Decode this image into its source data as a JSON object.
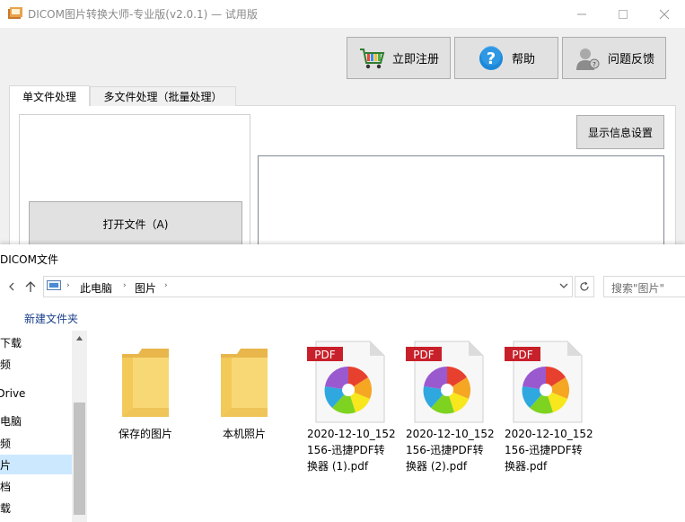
{
  "app": {
    "title": "DICOM图片转换大师-专业版(v2.0.1) — 试用版",
    "buttons": {
      "register": "立即注册",
      "help": "帮助",
      "feedback": "问题反馈"
    },
    "tabs": [
      {
        "label": "单文件处理",
        "active": true
      },
      {
        "label": "多文件处理（批量处理）",
        "active": false
      }
    ],
    "open_file": "打开文件（A)",
    "display_settings": "显示信息设置"
  },
  "dialog": {
    "title": "DICOM文件",
    "breadcrumb": [
      "此电脑",
      "图片"
    ],
    "search_placeholder": "搜索\"图片\"",
    "new_folder": "新建文件夹",
    "sidebar": [
      {
        "label": "安下载",
        "selected": false
      },
      {
        "label": "视频",
        "selected": false
      },
      {
        "label": "OneDrive",
        "selected": false
      },
      {
        "label": "此电脑",
        "selected": false
      },
      {
        "label": "视频",
        "selected": false
      },
      {
        "label": "图片",
        "selected": true
      },
      {
        "label": "文档",
        "selected": false
      },
      {
        "label": "下载",
        "selected": false
      }
    ],
    "files": [
      {
        "name_line1": "保存的图片",
        "name_line2": "",
        "name_line3": "",
        "type": "folder"
      },
      {
        "name_line1": "本机照片",
        "name_line2": "",
        "name_line3": "",
        "type": "folder"
      },
      {
        "name_line1": "2020-12-10_152",
        "name_line2": "156-迅捷PDF转",
        "name_line3": "换器 (1).pdf",
        "type": "pdf"
      },
      {
        "name_line1": "2020-12-10_152",
        "name_line2": "156-迅捷PDF转",
        "name_line3": "换器 (2).pdf",
        "type": "pdf"
      },
      {
        "name_line1": "2020-12-10_152",
        "name_line2": "156-迅捷PDF转",
        "name_line3": "换器.pdf",
        "type": "pdf"
      }
    ],
    "pdf_badge": "PDF"
  },
  "colors": {
    "selected_bg": "#cce8ff",
    "link": "#1a3f8a",
    "folder": "#f8d775",
    "pdf_badge": "#c8202a"
  }
}
